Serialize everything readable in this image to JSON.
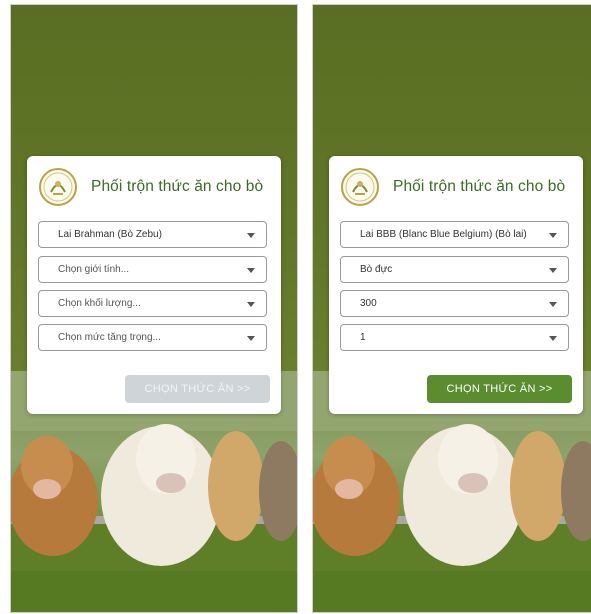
{
  "screens": [
    {
      "title": "Phối trộn thức ăn cho bò",
      "logo_text": "TRÀ VINH",
      "fields": [
        {
          "value": "Lai Brahman (Bò Zebu)",
          "placeholder": false
        },
        {
          "value": "Chọn giới tính...",
          "placeholder": true
        },
        {
          "value": "Chọn khối lượng...",
          "placeholder": true
        },
        {
          "value": "Chọn mức tăng trọng...",
          "placeholder": true
        }
      ],
      "button_label": "CHỌN THỨC ĂN >>",
      "button_state": "disabled"
    },
    {
      "title": "Phối trộn thức ăn cho bò",
      "logo_text": "TRÀ VINH",
      "fields": [
        {
          "value": "Lai BBB (Blanc Blue Belgium) (Bò lai)",
          "placeholder": false
        },
        {
          "value": "Bò đực",
          "placeholder": false
        },
        {
          "value": "300",
          "placeholder": false
        },
        {
          "value": "1",
          "placeholder": false
        }
      ],
      "button_label": "CHỌN THỨC ĂN >>",
      "button_state": "enabled"
    }
  ],
  "colors": {
    "brand_green": "#3d6b25",
    "button_enabled": "#5b8c30",
    "button_disabled": "#cfd4d9",
    "background_green": "#5f7327"
  }
}
